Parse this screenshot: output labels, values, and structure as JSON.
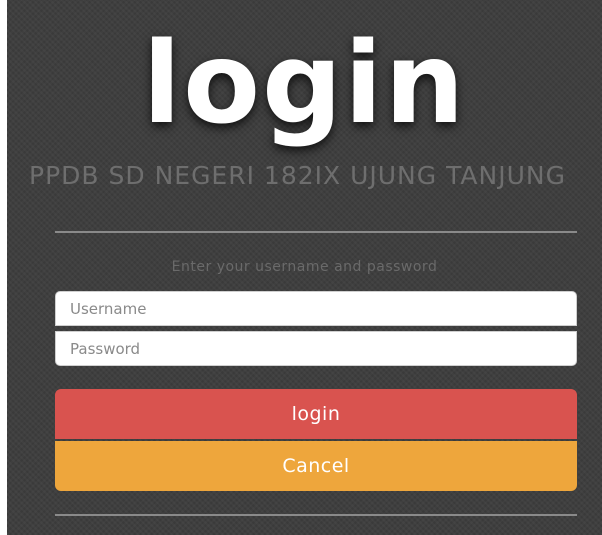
{
  "login_page": {
    "title": "login",
    "subtitle": "PPDB SD NEGERI 182IX UJUNG TANJUNG",
    "instruction": "Enter your username and password",
    "username_placeholder": "Username",
    "password_placeholder": "Password",
    "login_label": "login",
    "cancel_label": "Cancel"
  },
  "colors": {
    "background": "#3c3c3c",
    "login_button": "#d9534f",
    "cancel_button": "#eea63c"
  }
}
